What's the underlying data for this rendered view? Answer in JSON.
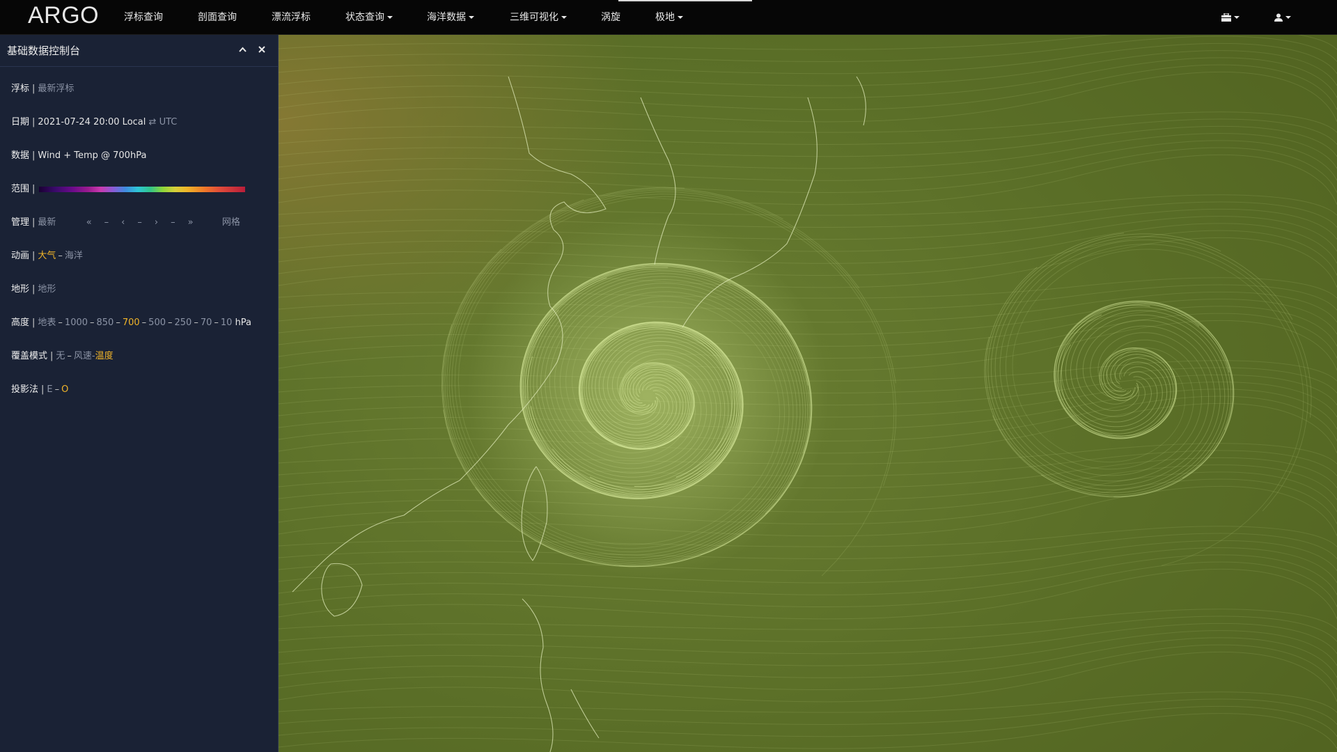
{
  "brand": "ARGO",
  "nav": [
    {
      "label": "浮标查询",
      "dropdown": false
    },
    {
      "label": "剖面查询",
      "dropdown": false
    },
    {
      "label": "漂流浮标",
      "dropdown": false
    },
    {
      "label": "状态查询",
      "dropdown": true
    },
    {
      "label": "海洋数据",
      "dropdown": true
    },
    {
      "label": "三维可视化",
      "dropdown": true
    },
    {
      "label": "涡旋",
      "dropdown": false
    },
    {
      "label": "极地",
      "dropdown": true
    }
  ],
  "nav_icons": {
    "left": "briefcase-icon",
    "right": "user-icon"
  },
  "panel": {
    "title": "基础数据控制台",
    "buoy": {
      "label": "浮标",
      "value": "最新浮标"
    },
    "date": {
      "label": "日期",
      "value": "2021-07-24 20:00 Local",
      "swap": "⇄",
      "alt": "UTC"
    },
    "data": {
      "label": "数据",
      "value": "Wind + Temp @ 700hPa"
    },
    "range": {
      "label": "范围"
    },
    "manage": {
      "label": "管理",
      "latest": "最新",
      "arrows": [
        "«",
        "–",
        "‹",
        "–",
        "›",
        "–",
        "»"
      ],
      "grid": "网格"
    },
    "anim": {
      "label": "动画",
      "air": "大气",
      "dash": "–",
      "ocean": "海洋"
    },
    "terrain": {
      "label": "地形",
      "value": "地形"
    },
    "height": {
      "label": "高度",
      "levels": [
        "地表",
        "1000",
        "850",
        "700",
        "500",
        "250",
        "70",
        "10"
      ],
      "active": "700",
      "unit": "hPa"
    },
    "overlay": {
      "label": "覆盖模式",
      "none": "无",
      "dash": "–",
      "wind": "风速-",
      "temp": "温度"
    },
    "projection": {
      "label": "投影法",
      "e": "E",
      "dash": "–",
      "o": "O"
    }
  },
  "colors": {
    "accent": "#f0b429",
    "panel_bg": "#1a2235",
    "map_bg": "#5c7029",
    "streamline": "#d6e89a"
  }
}
